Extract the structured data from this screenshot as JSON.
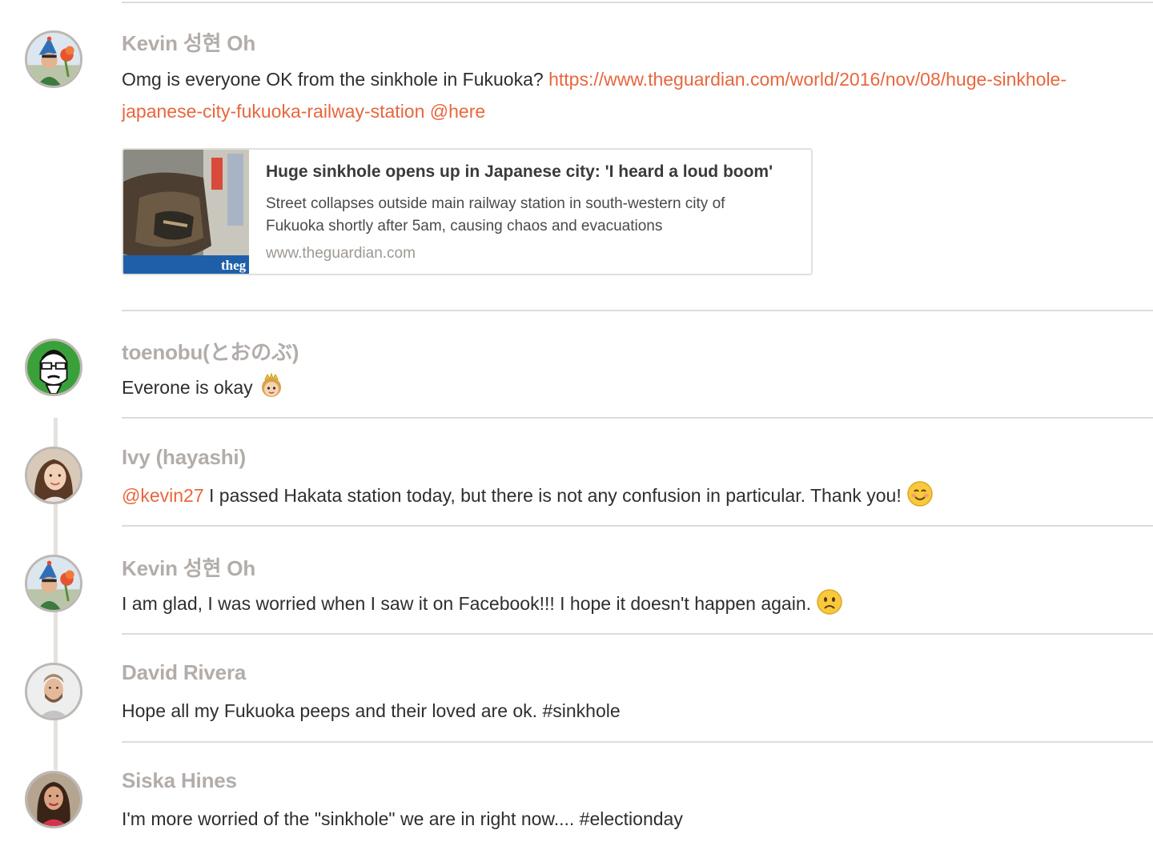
{
  "messages": [
    {
      "author": "Kevin 성현 Oh",
      "text": "Omg is everyone OK from the sinkhole in Fukuoka? ",
      "link": "https://www.theguardian.com/world/2016/nov/08/huge-sinkhole-japanese-city-fukuoka-railway-station",
      "mention": "@here",
      "avatar_icon": "avatar-kevin-icon",
      "attachment": {
        "title": "Huge sinkhole opens up in Japanese city: 'I heard a loud boom'",
        "description": "Street collapses outside main railway station in south-western city of Fukuoka shortly after 5am, causing chaos and evacuations",
        "domain": "www.theguardian.com",
        "thumb_watermark": "theg"
      }
    },
    {
      "author": "toenobu(とおのぶ)",
      "text": "Everone is okay",
      "avatar_icon": "avatar-toenobu-icon",
      "emoji": "princess-emoji-icon"
    },
    {
      "author": "Ivy (hayashi)",
      "mention": "@kevin27",
      "text": " I passed Hakata station today, but there is not any confusion in particular. Thank you!",
      "avatar_icon": "avatar-ivy-icon",
      "emoji": "smiling-face-emoji-icon"
    },
    {
      "author": "Kevin 성현 Oh",
      "text": "I am glad, I was worried when I saw it on Facebook!!! I hope it doesn't happen again.",
      "avatar_icon": "avatar-kevin-icon",
      "emoji": "frowning-face-emoji-icon"
    },
    {
      "author": "David Rivera",
      "text": "Hope all my Fukuoka peeps and their loved are ok. #sinkhole",
      "avatar_icon": "avatar-david-icon"
    },
    {
      "author": "Siska Hines",
      "text": "I'm more worried of the \"sinkhole\" we are in right now.... #electionday",
      "avatar_icon": "avatar-siska-icon"
    }
  ],
  "colors": {
    "accent": "#e8663e",
    "author": "#b3adaa",
    "divider": "#dedbd8"
  }
}
